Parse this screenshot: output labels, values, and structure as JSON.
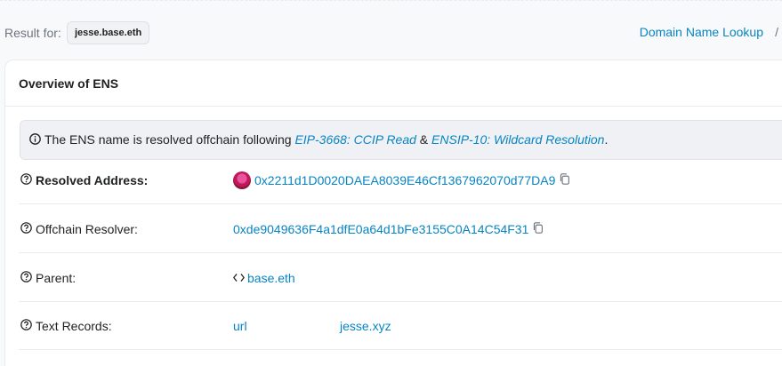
{
  "header": {
    "result_label": "Result for:",
    "query": "jesse.base.eth",
    "breadcrumb_link": "Domain Name Lookup",
    "breadcrumb_sep": "/"
  },
  "card": {
    "title": "Overview of ENS",
    "alert": {
      "prefix": "The ENS name is resolved offchain following ",
      "link1": "EIP-3668: CCIP Read",
      "middle": " & ",
      "link2": "ENSIP-10: Wildcard Resolution",
      "suffix": "."
    },
    "rows": {
      "resolved": {
        "label": "Resolved Address:",
        "value": "0x2211d1D0020DAEA8039E46Cf1367962070d77DA9"
      },
      "resolver": {
        "label": "Offchain Resolver:",
        "value": "0xde9049636F4a1dfE0a64d1bFe3155C0A14C54F31"
      },
      "parent": {
        "label": "Parent:",
        "value": "base.eth"
      },
      "text_records": {
        "label": "Text Records:",
        "key": "url",
        "value": "jesse.xyz"
      }
    }
  },
  "colors": {
    "link": "#0784c3",
    "muted": "#6c757e",
    "border": "#e9ecef"
  },
  "icons": [
    "info-icon",
    "question-circle-icon",
    "copy-icon",
    "avatar-icon",
    "code-brackets-icon"
  ]
}
